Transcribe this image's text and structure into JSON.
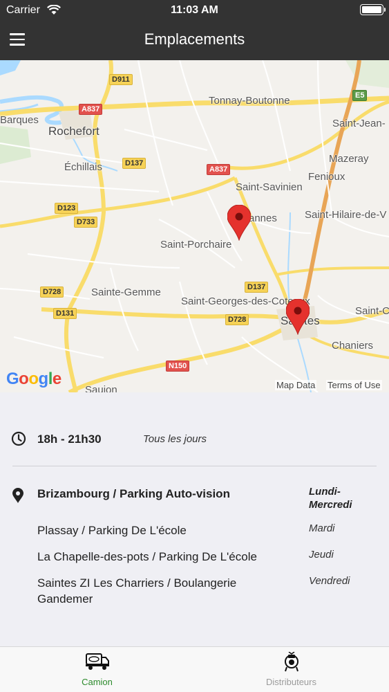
{
  "status_bar": {
    "carrier": "Carrier",
    "time": "11:03 AM"
  },
  "nav": {
    "title": "Emplacements",
    "menu_icon": "hamburger-menu-icon"
  },
  "map": {
    "places": [
      "Rochefort",
      "Barques",
      "Tonnay-Boutonne",
      "Saint-Jean-",
      "Échillais",
      "Mazeray",
      "Saint-Savinien",
      "Fenioux",
      "Saint-Hilaire-de-V",
      "Saint-Porchaire",
      "Sainte-Gemme",
      "Saint-Georges-des-Coteaux",
      "Saintes",
      "Saint-C",
      "Chaniers",
      "Saujon",
      "annes"
    ],
    "roads": [
      "D911",
      "A837",
      "E5",
      "D137",
      "A837",
      "D123",
      "D733",
      "D137",
      "D728",
      "D131",
      "D728",
      "N150"
    ],
    "google": "Google",
    "map_data": "Map Data",
    "terms": "Terms of Use",
    "pin_color": "#e5322d"
  },
  "schedule": {
    "hours": "18h - 21h30",
    "days": "Tous les jours",
    "locations": [
      {
        "place": "Brizambourg / Parking Auto-vision",
        "day": "Lundi-Mercredi",
        "day_l1": "Lundi-",
        "day_l2": "Mercredi"
      },
      {
        "place": "Plassay / Parking De L'école",
        "day": "Mardi"
      },
      {
        "place": "La Chapelle-des-pots / Parking De L'école",
        "day": "Jeudi"
      },
      {
        "place": "Saintes ZI Les Charriers / Boulangerie Gandemer",
        "day": "Vendredi",
        "place_l1": "Saintes ZI Les Charriers / Boulangerie",
        "place_l2": "Gandemer"
      }
    ]
  },
  "tabs": [
    {
      "label": "Camion",
      "icon": "truck-icon",
      "active": true
    },
    {
      "label": "Distributeurs",
      "icon": "vending-machine-icon",
      "active": false
    }
  ],
  "colors": {
    "header": "#333333",
    "active_tab": "#2b8a2b",
    "inactive_tab": "#9b9b9b"
  }
}
